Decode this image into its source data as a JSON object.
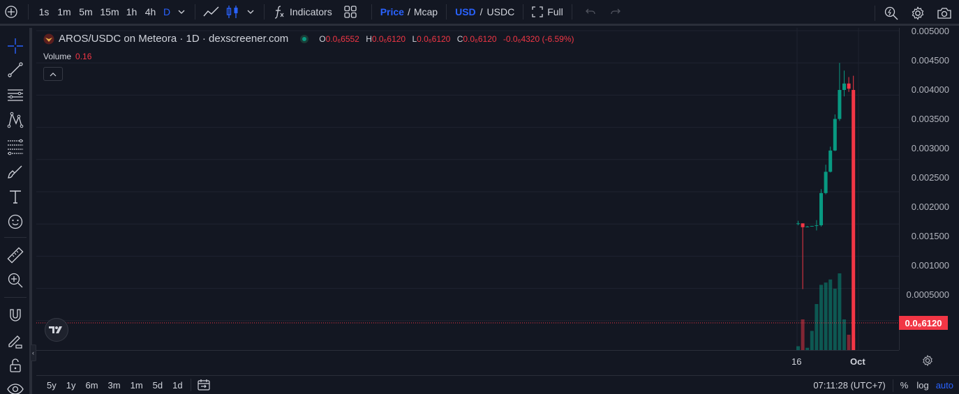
{
  "toolbar": {
    "timeframes": [
      "1s",
      "1m",
      "5m",
      "15m",
      "1h",
      "4h",
      "D"
    ],
    "indicators_label": "Indicators",
    "price_label": "Price",
    "mcap_label": "Mcap",
    "slash": "/",
    "usd_label": "USD",
    "usdc_label": "USDC",
    "full_label": "Full"
  },
  "legend": {
    "title": "AROS/USDC on Meteora · 1D · dexscreener.com",
    "o_key": "O",
    "o_val": "0.0₆6552",
    "h_key": "H",
    "h_val": "0.0₆6120",
    "l_key": "L",
    "l_val": "0.0₆6120",
    "c_key": "C",
    "c_val": "0.0₆6120",
    "change": "-0.0₆4320 (-6.59%)"
  },
  "volume": {
    "label": "Volume",
    "value": "0.16"
  },
  "price_axis": {
    "labels": [
      "0.005000",
      "0.004500",
      "0.004000",
      "0.003500",
      "0.003000",
      "0.002500",
      "0.002000",
      "0.001500",
      "0.001000",
      "0.0005000"
    ],
    "last_price": "0.0₆6120"
  },
  "time_axis": {
    "labels": [
      "16",
      "Oct"
    ]
  },
  "bottombar": {
    "ranges": [
      "5y",
      "1y",
      "6m",
      "3m",
      "1m",
      "5d",
      "1d"
    ],
    "clock": "07:11:28 (UTC+7)",
    "percent": "%",
    "log": "log",
    "auto": "auto"
  },
  "colors": {
    "up": "#089981",
    "down": "#f23645",
    "accent": "#2962ff",
    "bg": "#131722"
  },
  "chart_data": {
    "type": "candlestick",
    "ylim": [
      0,
      0.005
    ],
    "candles": [
      {
        "o": 0.002,
        "h": 0.00205,
        "l": 0.00198,
        "c": 0.00201
      },
      {
        "o": 0.00201,
        "h": 0.00201,
        "l": 0.00099,
        "c": 0.00195
      },
      {
        "o": 0.00195,
        "h": 0.00197,
        "l": 0.00195,
        "c": 0.00196
      },
      {
        "o": 0.00196,
        "h": 0.00197,
        "l": 0.00196,
        "c": 0.00197
      },
      {
        "o": 0.00197,
        "h": 0.00206,
        "l": 0.0019,
        "c": 0.00198
      },
      {
        "o": 0.00198,
        "h": 0.00254,
        "l": 0.00196,
        "c": 0.00248
      },
      {
        "o": 0.00248,
        "h": 0.00292,
        "l": 0.00246,
        "c": 0.00281
      },
      {
        "o": 0.00281,
        "h": 0.0032,
        "l": 0.0028,
        "c": 0.00314
      },
      {
        "o": 0.00314,
        "h": 0.0037,
        "l": 0.00313,
        "c": 0.00363
      },
      {
        "o": 0.00363,
        "h": 0.0045,
        "l": 0.0036,
        "c": 0.00408
      },
      {
        "o": 0.00408,
        "h": 0.00438,
        "l": 0.00398,
        "c": 0.00418
      },
      {
        "o": 0.00418,
        "h": 0.00428,
        "l": 0.00405,
        "c": 0.0041
      },
      {
        "o": 0.00408,
        "h": 0.0043,
        "l": 6.12e-07,
        "c": 6.12e-07
      }
    ],
    "volumes": [
      0.05,
      0.4,
      0.03,
      0.25,
      0.6,
      0.85,
      0.88,
      0.92,
      0.8,
      1.0,
      0.4,
      0.2,
      0.16
    ]
  }
}
